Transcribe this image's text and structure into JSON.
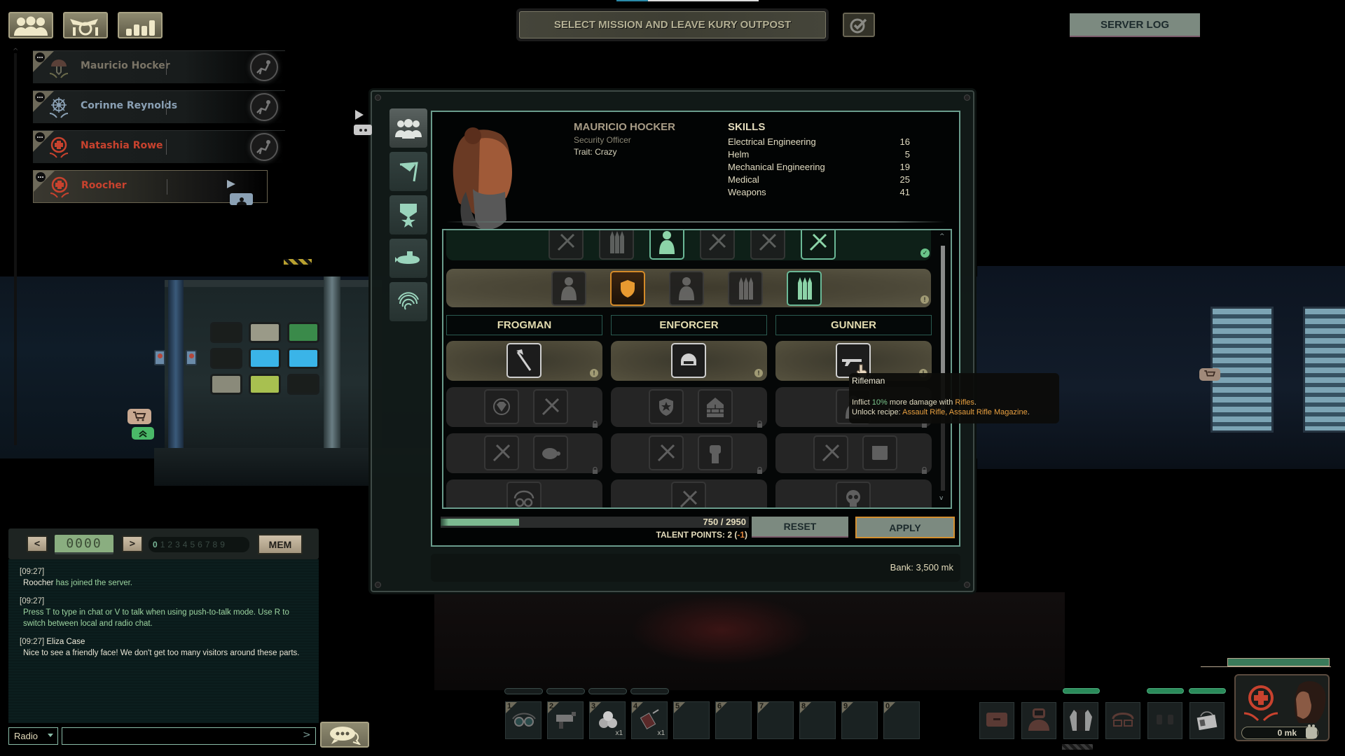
{
  "top_tabs": [
    {
      "id": "crew",
      "icon": "crew-icon"
    },
    {
      "id": "character",
      "icon": "character-icon"
    },
    {
      "id": "stats",
      "icon": "stats-icon"
    }
  ],
  "crew": [
    {
      "name": "Mauricio Hocker",
      "job": "security",
      "color": "#7a7466",
      "selected": false
    },
    {
      "name": "Corinne Reynolds",
      "job": "captain",
      "color": "#8aa0b4",
      "selected": false
    },
    {
      "name": "Natashia Rowe",
      "job": "medic",
      "color": "#c8422e",
      "selected": false
    },
    {
      "name": "Roocher",
      "job": "medic",
      "color": "#c8422e",
      "selected": true
    }
  ],
  "header": {
    "mission_button": "SELECT MISSION AND LEAVE KURY OUTPOST",
    "server_log": "SERVER LOG"
  },
  "character": {
    "name": "MAURICIO HOCKER",
    "job": "Security Officer",
    "trait": "Trait: Crazy",
    "skills_title": "SKILLS",
    "skills": [
      {
        "name": "Electrical Engineering",
        "value": "16"
      },
      {
        "name": "Helm",
        "value": "5"
      },
      {
        "name": "Mechanical Engineering",
        "value": "19"
      },
      {
        "name": "Medical",
        "value": "25"
      },
      {
        "name": "Weapons",
        "value": "41"
      }
    ]
  },
  "talents": {
    "specializations": [
      "FROGMAN",
      "ENFORCER",
      "GUNNER"
    ],
    "tooltip": {
      "title": "Rifleman",
      "line1_pre": "Inflict ",
      "line1_pct": "10%",
      "line1_mid": " more damage with ",
      "line1_item": "Rifles",
      "line1_end": ".",
      "line2_pre": "Unlock recipe: ",
      "line2_items": "Assault Rifle, Assault Rifle Magazine",
      "line2_end": "."
    },
    "xp_current": 750,
    "xp_max": 2950,
    "xp_text": "750 / 2950",
    "points_label": "TALENT POINTS: 2 (",
    "points_delta": "-1",
    "points_close": ")",
    "reset_label": "RESET",
    "apply_label": "APPLY",
    "bank": "Bank: 3,500 mk"
  },
  "chat": {
    "channel_display": "0000",
    "prev_label": "<",
    "next_label": ">",
    "digits": [
      "0",
      "1",
      "2",
      "3",
      "4",
      "5",
      "6",
      "7",
      "8",
      "9"
    ],
    "active_digit": "0",
    "mem_label": "MEM",
    "messages": [
      {
        "time": "[09:27]",
        "sender": "",
        "text": "Roocher has joined the server.",
        "highlight_name": "Roocher",
        "rest": " has joined the server."
      },
      {
        "time": "[09:27]",
        "sender": "",
        "text": "Press T to type in chat or V to talk when using push-to-talk mode. Use R to switch between local and radio chat."
      },
      {
        "time": "[09:27] ",
        "sender": "Eliza Case",
        "text": "Nice to see a friendly face! We don't get too many visitors around these parts."
      }
    ],
    "mode": "Radio",
    "input_value": "",
    "send_icon": ">"
  },
  "hotbar": {
    "slots": [
      {
        "key": "1",
        "item": "diving-goggles",
        "qty": ""
      },
      {
        "key": "2",
        "item": "welding-tool",
        "qty": ""
      },
      {
        "key": "3",
        "item": "bandage",
        "qty": "x1"
      },
      {
        "key": "4",
        "item": "medical-syringe",
        "qty": "x1"
      },
      {
        "key": "5",
        "item": "",
        "qty": ""
      },
      {
        "key": "6",
        "item": "",
        "qty": ""
      },
      {
        "key": "7",
        "item": "",
        "qty": ""
      },
      {
        "key": "8",
        "item": "",
        "qty": ""
      },
      {
        "key": "9",
        "item": "",
        "qty": ""
      },
      {
        "key": "0",
        "item": "",
        "qty": ""
      }
    ]
  },
  "equipment": [
    "bag",
    "diving-suit",
    "body-armor",
    "glasses",
    "headset",
    "id-card"
  ],
  "player": {
    "money": "0 mk",
    "health_fraction": 1.0
  }
}
